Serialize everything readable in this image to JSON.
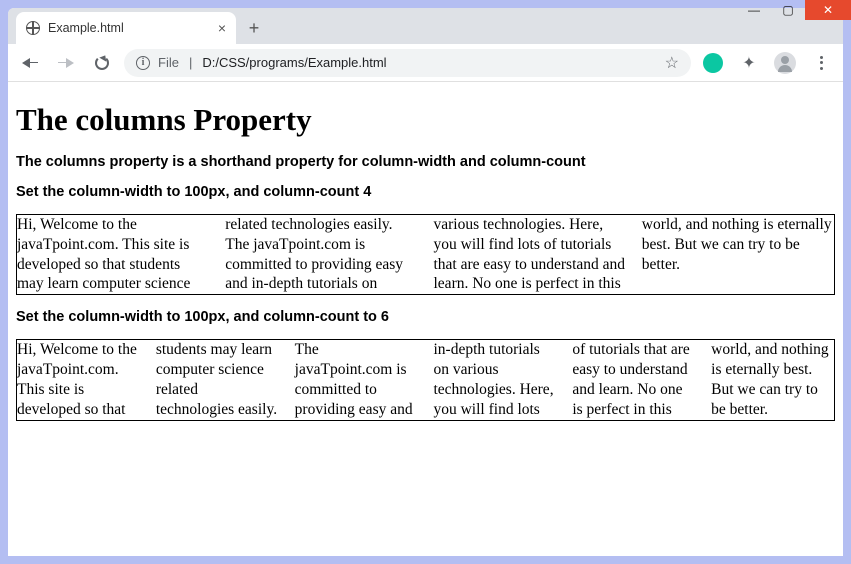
{
  "window": {
    "tab_title": "Example.html",
    "new_tab_label": "+",
    "close_tab_label": "×",
    "min_label": "—",
    "max_label": "▢",
    "close_label": "✕"
  },
  "toolbar": {
    "info_label": "i",
    "file_prefix": "File",
    "url_path": "D:/CSS/programs/Example.html",
    "star_label": "☆",
    "puzzle_label": "✦",
    "menu_label": "⋮"
  },
  "content": {
    "h1": "The columns Property",
    "intro": "The columns property is a shorthand property for column-width and column-count",
    "h3a": "Set the column-width to 100px, and column-count 4",
    "h3b": "Set the column-width to 100px, and column-count to 6",
    "paragraph": "Hi, Welcome to the javaTpoint.com. This site is developed so that students may learn computer science related technologies easily. The javaTpoint.com is committed to providing easy and in-depth tutorials on various technologies. Here, you will find lots of tutorials that are easy to understand and learn. No one is perfect in this world, and nothing is eternally best. But we can try to be better."
  }
}
